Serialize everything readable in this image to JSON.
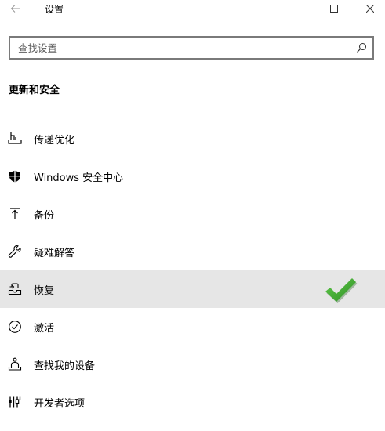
{
  "window": {
    "title": "设置",
    "controls": [
      "minimize",
      "maximize",
      "close"
    ]
  },
  "search": {
    "placeholder": "查找设置",
    "value": ""
  },
  "section": {
    "title": "更新和安全"
  },
  "nav": {
    "selected_index": 4,
    "items": [
      {
        "label": "传递优化",
        "icon": "delivery-optimization-icon"
      },
      {
        "label": "Windows 安全中心",
        "icon": "shield-icon"
      },
      {
        "label": "备份",
        "icon": "backup-arrow-up-icon"
      },
      {
        "label": "疑难解答",
        "icon": "wrench-icon"
      },
      {
        "label": "恢复",
        "icon": "recovery-icon"
      },
      {
        "label": "激活",
        "icon": "check-circle-icon"
      },
      {
        "label": "查找我的设备",
        "icon": "find-device-person-icon"
      },
      {
        "label": "开发者选项",
        "icon": "developer-tools-icon"
      }
    ]
  },
  "annotation": {
    "icon": "green-checkmark-icon",
    "color": "#3aa52e"
  }
}
